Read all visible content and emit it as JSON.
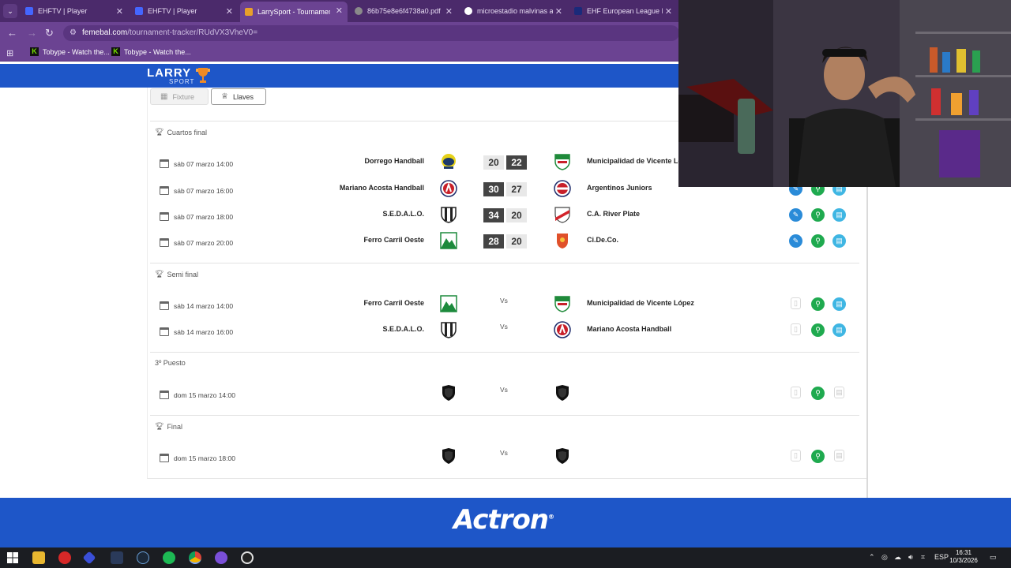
{
  "browser": {
    "tabs": [
      {
        "title": "EHFTV | Player",
        "favicon_color": "#4466ff"
      },
      {
        "title": "EHFTV | Player",
        "favicon_color": "#4466ff"
      },
      {
        "title": "LarrySport - Tournament Tr",
        "favicon_color": "#e8a02a"
      },
      {
        "title": "86b75e8e6f4738a0.pdf",
        "favicon_color": "#8a8a8a"
      },
      {
        "title": "microestadio malvinas arg",
        "favicon_color": "#ffffff"
      },
      {
        "title": "EHF European League Me",
        "favicon_color": "#1a2a7a"
      }
    ],
    "active_tab_index": 2,
    "url_host": "femebal.com",
    "url_path": "/tournament-tracker/RUdVX3VheV0=",
    "bookmarks": [
      "Tobype - Watch the...",
      "Tobype - Watch the..."
    ]
  },
  "site": {
    "logo_text": "LARRY",
    "logo_sub": "SPORT",
    "view_tabs": {
      "fixture": "Fixture",
      "llaves": "Llaves"
    },
    "sections": [
      {
        "title": "Cuartos final",
        "matches": [
          {
            "date": "sáb 07 marzo 14:00",
            "home": "Dorrego Handball",
            "away": "Municipalidad de Vicente Lo",
            "home_score": "20",
            "away_score": "22",
            "winner": "away",
            "home_crest": "#1d3a6b",
            "away_crest": "#1f8a3a"
          },
          {
            "date": "sáb 07 marzo 16:00",
            "home": "Mariano Acosta Handball",
            "away": "Argentinos Juniors",
            "home_score": "30",
            "away_score": "27",
            "winner": "home",
            "home_crest": "#c8202a",
            "away_crest": "#c8202a"
          },
          {
            "date": "sáb 07 marzo 18:00",
            "home": "S.E.D.A.L.O.",
            "away": "C.A. River Plate",
            "home_score": "34",
            "away_score": "20",
            "winner": "home",
            "home_crest": "#222222",
            "away_crest": "#d3232a"
          },
          {
            "date": "sáb 07 marzo 20:00",
            "home": "Ferro Carril Oeste",
            "away": "Ci.De.Co.",
            "home_score": "28",
            "away_score": "20",
            "winner": "home",
            "home_crest": "#1c8a3c",
            "away_crest": "#e0502a"
          }
        ]
      },
      {
        "title": "Semi final",
        "matches": [
          {
            "date": "sáb 14 marzo 14:00",
            "home": "Ferro Carril Oeste",
            "away": "Municipalidad de Vicente López",
            "vs": "Vs",
            "home_crest": "#1c8a3c",
            "away_crest": "#1f8a3a"
          },
          {
            "date": "sáb 14 marzo 16:00",
            "home": "S.E.D.A.L.O.",
            "away": "Mariano Acosta Handball",
            "vs": "Vs",
            "home_crest": "#222222",
            "away_crest": "#c8202a"
          }
        ]
      },
      {
        "title": "3º Puesto",
        "matches": [
          {
            "date": "dom 15 marzo 14:00",
            "home": "",
            "away": "",
            "vs": "Vs",
            "home_crest": "#111111",
            "away_crest": "#111111"
          }
        ]
      },
      {
        "title": "Final",
        "matches": [
          {
            "date": "dom 15 marzo 18:00",
            "home": "",
            "away": "",
            "vs": "Vs",
            "home_crest": "#111111",
            "away_crest": "#111111"
          }
        ]
      }
    ],
    "sponsor": "Actron"
  },
  "taskbar": {
    "language": "ESP",
    "time": "16:31",
    "date": "10/3/2026"
  },
  "colors": {
    "header_blue": "#1e56c8",
    "browser_purple": "#6b4392",
    "win_score_bg": "#444444",
    "action_blue": "#2a8bd8",
    "action_green": "#1faa4f",
    "action_cyan": "#3fb6e3"
  }
}
